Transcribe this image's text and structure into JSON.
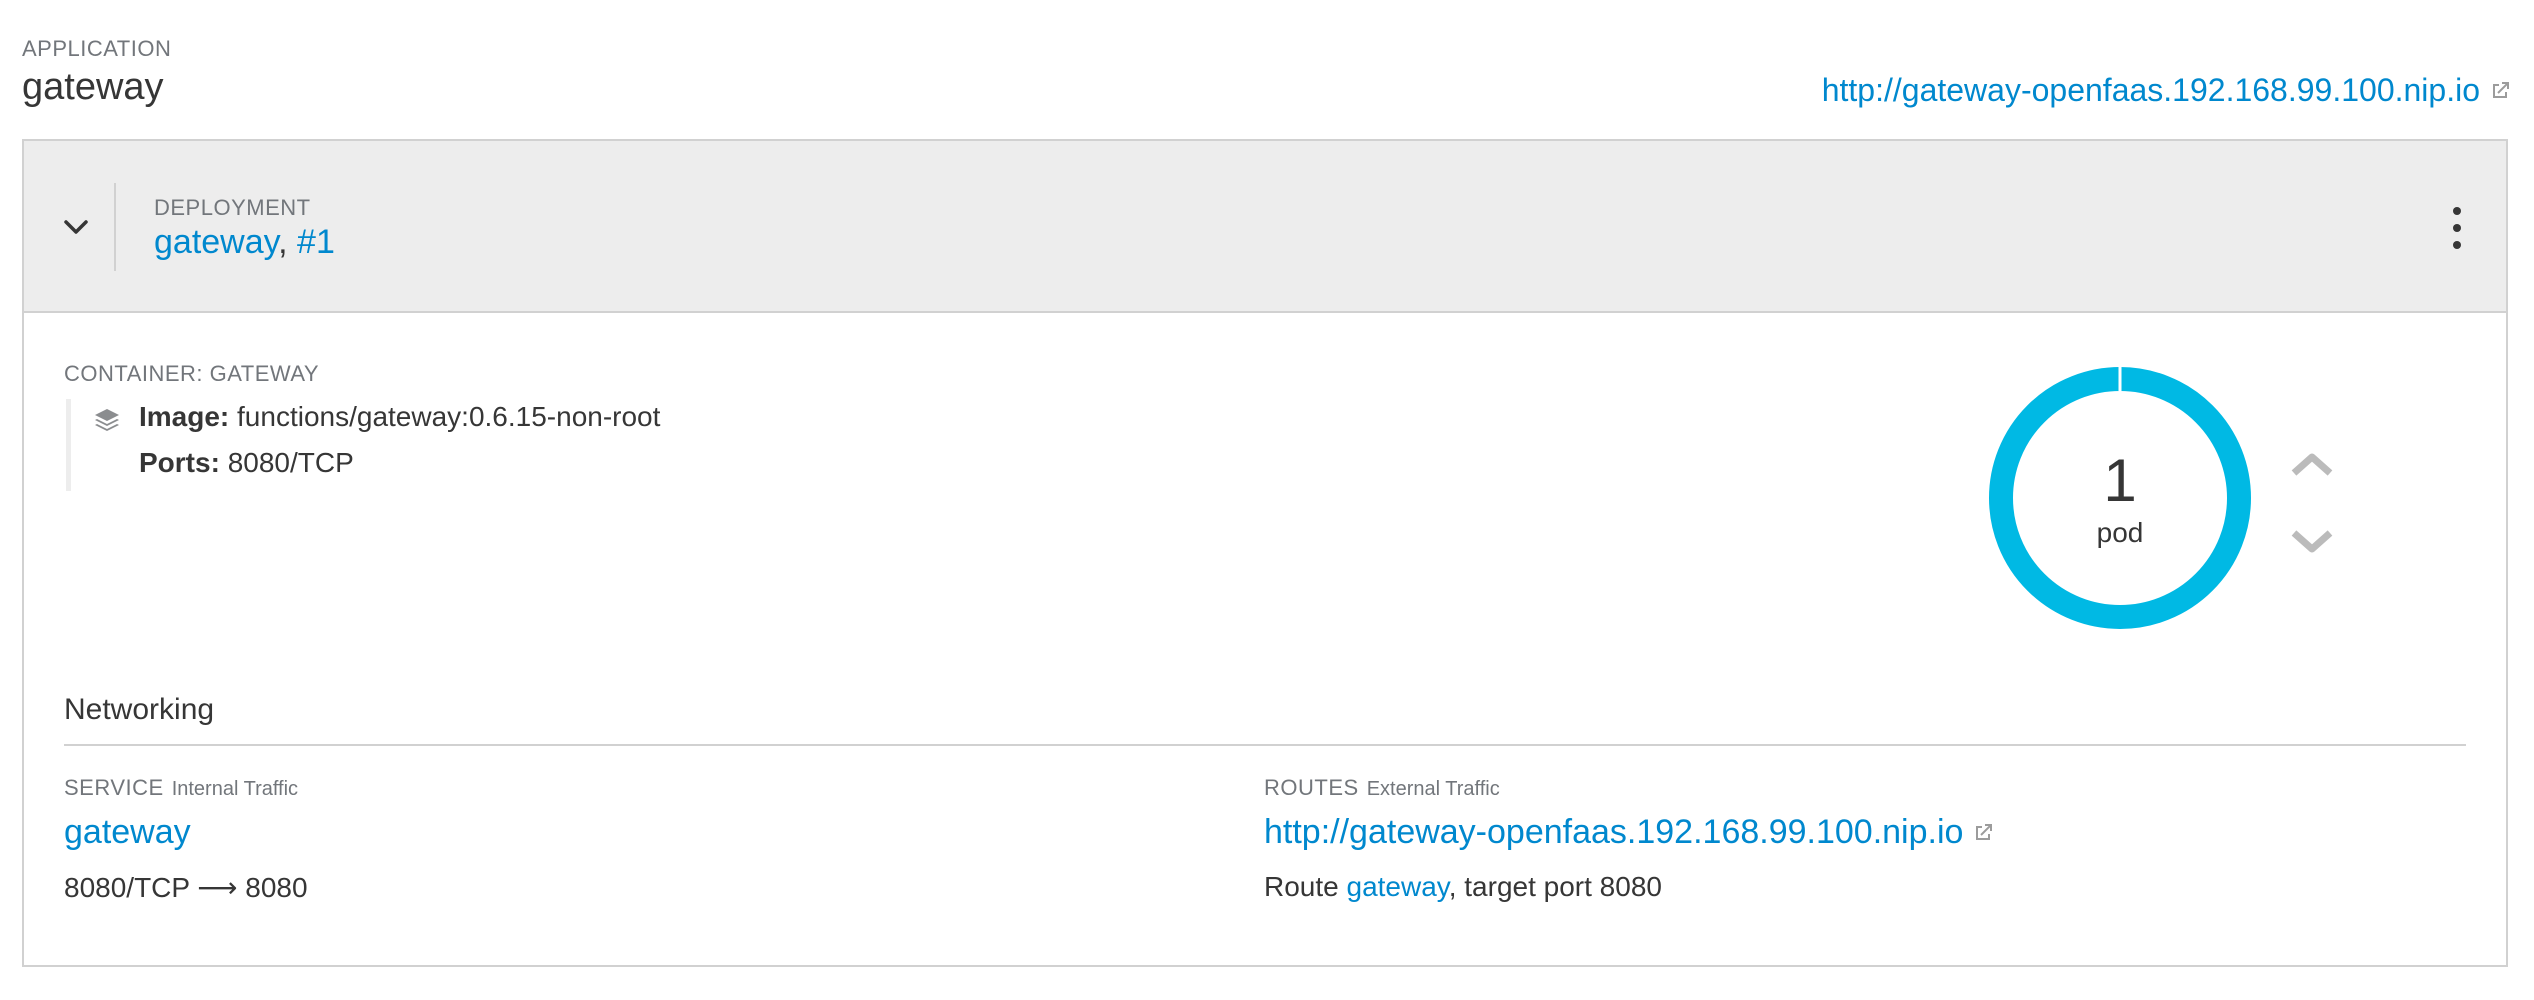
{
  "application": {
    "label": "APPLICATION",
    "name": "gateway",
    "url": "http://gateway-openfaas.192.168.99.100.nip.io"
  },
  "deployment": {
    "label": "DEPLOYMENT",
    "name": "gateway",
    "separator": ", ",
    "revision": "#1"
  },
  "container": {
    "label": "CONTAINER: GATEWAY",
    "image_label": "Image:",
    "image_value": "functions/gateway:0.6.15-non-root",
    "ports_label": "Ports:",
    "ports_value": "8080/TCP"
  },
  "pods": {
    "count": "1",
    "label": "pod",
    "ring_color": "#00b9e4"
  },
  "networking": {
    "title": "Networking",
    "service": {
      "label": "SERVICE",
      "sublabel": "Internal Traffic",
      "name": "gateway",
      "ports": "8080/TCP ⟶ 8080"
    },
    "routes": {
      "label": "ROUTES",
      "sublabel": "External Traffic",
      "url": "http://gateway-openfaas.192.168.99.100.nip.io",
      "desc_prefix": "Route ",
      "route_name": "gateway",
      "desc_suffix": ", target port 8080"
    }
  },
  "icons": {
    "external_link": "external-link-icon",
    "expand": "chevron-down-icon",
    "menu": "kebab-menu-icon",
    "image": "layers-icon",
    "scale_up": "chevron-up-icon",
    "scale_down": "chevron-down-icon"
  },
  "colors": {
    "link": "#0088ce",
    "header_bg": "#ededed",
    "muted": "#72767b"
  }
}
